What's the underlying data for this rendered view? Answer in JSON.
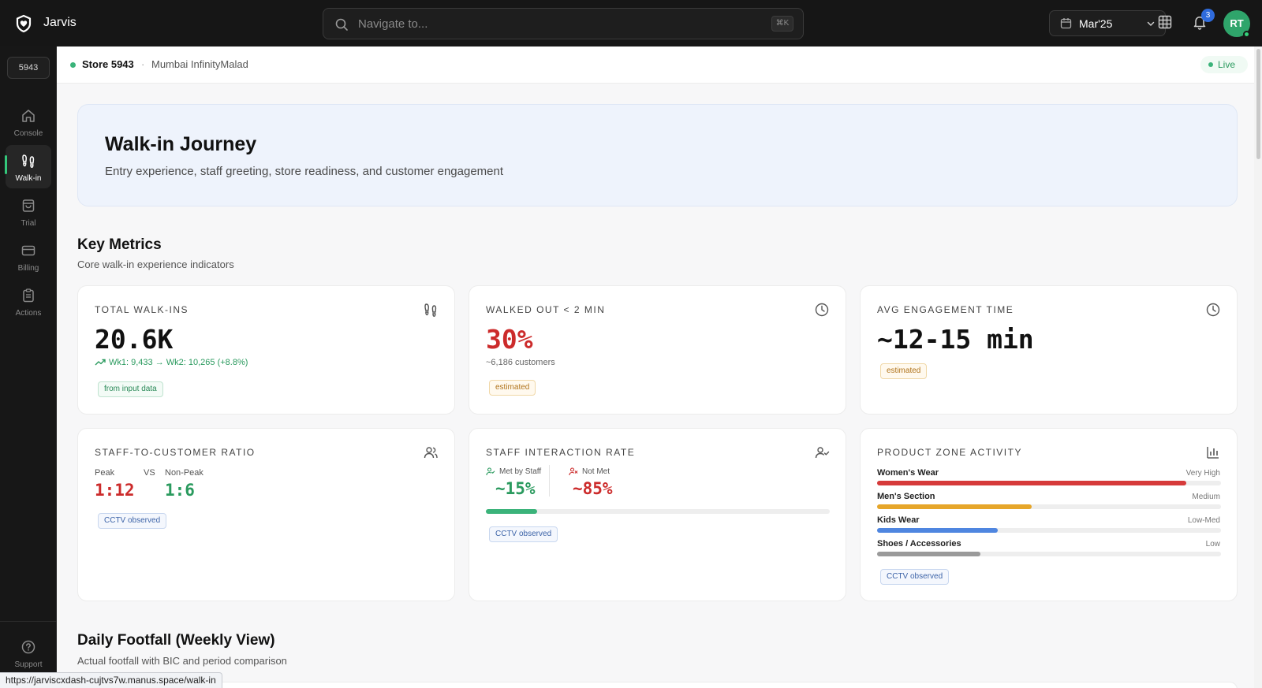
{
  "app": {
    "name": "Jarvis"
  },
  "search": {
    "placeholder": "Navigate to...",
    "shortcut": "⌘K"
  },
  "date_picker": {
    "value": "Mar'25"
  },
  "notifications": {
    "count": "3"
  },
  "user": {
    "initials": "RT"
  },
  "sidebar": {
    "store_chip": "5943",
    "items": [
      {
        "label": "Console",
        "icon": "home-icon"
      },
      {
        "label": "Walk-in",
        "icon": "footprints-icon",
        "active": true
      },
      {
        "label": "Trial",
        "icon": "bag-icon"
      },
      {
        "label": "Billing",
        "icon": "card-icon"
      },
      {
        "label": "Actions",
        "icon": "clipboard-icon"
      }
    ],
    "support_label": "Support"
  },
  "subheader": {
    "store": "Store 5943",
    "separator": "·",
    "location": "Mumbai InfinityMalad",
    "status": "Live"
  },
  "hero": {
    "title": "Walk-in Journey",
    "subtitle": "Entry experience, staff greeting, store readiness, and customer engagement"
  },
  "key_metrics": {
    "title": "Key Metrics",
    "subtitle": "Core walk-in experience indicators",
    "total_walkins": {
      "title": "TOTAL WALK-INS",
      "value": "20.6K",
      "trend": "Wk1: 9,433 → Wk2: 10,265 (+8.8%)",
      "tag": "from input data"
    },
    "walked_out": {
      "title": "WALKED OUT < 2 MIN",
      "value": "30%",
      "detail": "~6,186 customers",
      "tag": "estimated"
    },
    "avg_engagement": {
      "title": "AVG ENGAGEMENT TIME",
      "value": "~12-15 min",
      "tag": "estimated"
    },
    "staff_ratio": {
      "title": "STAFF-TO-CUSTOMER RATIO",
      "peak_label": "Peak",
      "vs_label": "VS",
      "nonpeak_label": "Non-Peak",
      "peak_value": "1:12",
      "nonpeak_value": "1:6",
      "tag": "CCTV observed"
    },
    "interaction_rate": {
      "title": "STAFF INTERACTION RATE",
      "met_label": "Met by Staff",
      "notmet_label": "Not Met",
      "met_value": "~15%",
      "notmet_value": "~85%",
      "met_fraction": 0.15,
      "tag": "CCTV observed"
    },
    "zone_activity": {
      "title": "PRODUCT ZONE ACTIVITY",
      "zones": [
        {
          "name": "Women's Wear",
          "level": "Very High",
          "fraction": 0.9,
          "color": "#d63a3a"
        },
        {
          "name": "Men's Section",
          "level": "Medium",
          "fraction": 0.45,
          "color": "#e6a62a"
        },
        {
          "name": "Kids Wear",
          "level": "Low-Med",
          "fraction": 0.35,
          "color": "#4f86e0"
        },
        {
          "name": "Shoes / Accessories",
          "level": "Low",
          "fraction": 0.3,
          "color": "#9a9a9a"
        }
      ],
      "tag": "CCTV observed"
    }
  },
  "footfall": {
    "title": "Daily Footfall (Weekly View)",
    "subtitle": "Actual footfall with BIC and period comparison"
  },
  "status_url": "https://jarviscxdash-cujtvs7w.manus.space/walk-in"
}
